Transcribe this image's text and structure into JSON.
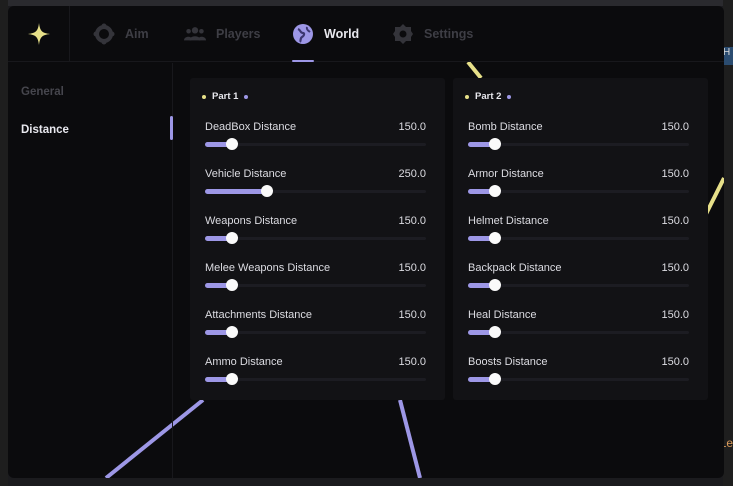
{
  "colors": {
    "accent": "#9d97e6",
    "dot_yellow": "#e7e089",
    "window_bg": "#0b0b0d",
    "panel_bg": "#121215"
  },
  "tabs": [
    {
      "label": "Aim",
      "icon": "gamepad-icon",
      "active": false
    },
    {
      "label": "Players",
      "icon": "users-icon",
      "active": false
    },
    {
      "label": "World",
      "icon": "globe-icon",
      "active": true
    },
    {
      "label": "Settings",
      "icon": "gear-icon",
      "active": false
    }
  ],
  "sidebar": {
    "items": [
      {
        "label": "General",
        "active": false
      },
      {
        "label": "Distance",
        "active": true
      }
    ]
  },
  "panels": [
    {
      "title": "Part 1",
      "sliders": [
        {
          "label": "DeadBox Distance",
          "value": "150.0",
          "fraction": 0.12
        },
        {
          "label": "Vehicle Distance",
          "value": "250.0",
          "fraction": 0.28
        },
        {
          "label": "Weapons Distance",
          "value": "150.0",
          "fraction": 0.12
        },
        {
          "label": "Melee Weapons Distance",
          "value": "150.0",
          "fraction": 0.12
        },
        {
          "label": "Attachments Distance",
          "value": "150.0",
          "fraction": 0.12
        },
        {
          "label": "Ammo Distance",
          "value": "150.0",
          "fraction": 0.12
        }
      ]
    },
    {
      "title": "Part 2",
      "sliders": [
        {
          "label": "Bomb Distance",
          "value": "150.0",
          "fraction": 0.12
        },
        {
          "label": "Armor Distance",
          "value": "150.0",
          "fraction": 0.12
        },
        {
          "label": "Helmet Distance",
          "value": "150.0",
          "fraction": 0.12
        },
        {
          "label": "Backpack Distance",
          "value": "150.0",
          "fraction": 0.12
        },
        {
          "label": "Heal Distance",
          "value": "150.0",
          "fraction": 0.12
        },
        {
          "label": "Boosts Distance",
          "value": "150.0",
          "fraction": 0.12
        }
      ]
    }
  ],
  "background_editor": {
    "right_marker": "H",
    "right_text": "Le"
  }
}
